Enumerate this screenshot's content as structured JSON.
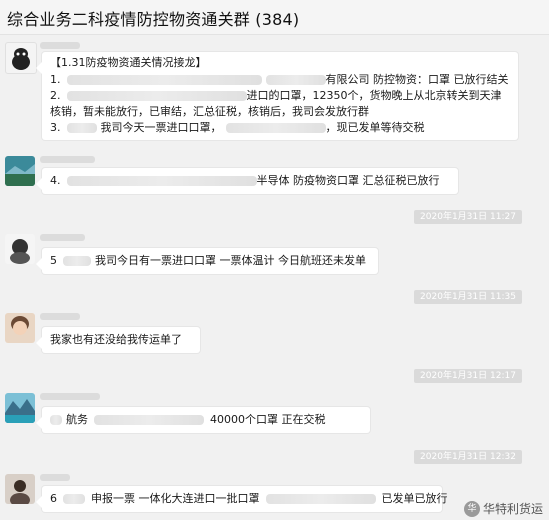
{
  "window": {
    "title": "综合业务二科疫情防控物资通关群 (384)"
  },
  "messages": [
    {
      "lines": [
        "【1.31防疫物资通关情况接龙】",
        "1.",
        "有限公司 防控物资：口罩 已放行结关",
        "2.",
        "进口的口罩，12350个，货物晚上从北京转关到天津",
        "核销，暂未能放行，已审结，汇总征税，核销后，我司会发放行群",
        "3.",
        "我司今天一票进口口罩，",
        "，现已发单等待交税"
      ]
    },
    {
      "lines": [
        "4.",
        "半导体 防疫物资口罩 汇总征税已放行"
      ]
    },
    {
      "lines": [
        "5",
        "我司今日有一票进口口罩 一票体温计 今日航班还未发单"
      ]
    },
    {
      "lines": [
        "我家也有还没给我传运单了"
      ]
    },
    {
      "lines": [
        "航务",
        "40000个口罩 正在交税"
      ]
    },
    {
      "lines": [
        "6",
        "申报一票 一体化大连进口一批口罩",
        "已发单已放行"
      ]
    }
  ],
  "timestamps": [
    "2020年1月31日 11:27",
    "2020年1月31日 11:35",
    "2020年1月31日 12:17",
    "2020年1月31日 12:32"
  ],
  "watermark": {
    "text": "华特利货运",
    "badge": "华"
  }
}
